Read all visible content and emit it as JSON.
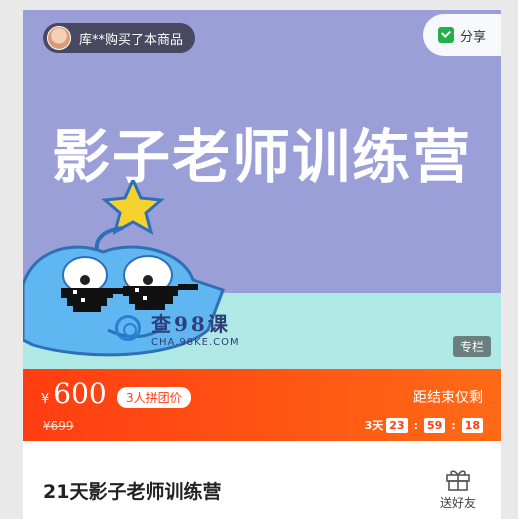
{
  "banner": {
    "buyer_notice": "库**购买了本商品",
    "share_label": "分享",
    "title": "影子老师训练营",
    "watermark_cn": "查98课",
    "watermark_en": "CHA.98KE.COM",
    "tag": "专栏"
  },
  "price_bar": {
    "currency": "¥",
    "price": "600",
    "group_badge": "3人拼团价",
    "original_price": "¥699",
    "countdown_label": "距结束仅剩",
    "countdown": {
      "days": "3天",
      "hours": "23",
      "minutes": "59",
      "seconds": "18",
      "separator": ":"
    }
  },
  "product": {
    "title": "21天影子老师训练营",
    "gift_label": "送好友"
  },
  "colors": {
    "banner_bg": "#9b9fd8",
    "banner_floor": "#aee9e6",
    "price_bar_start": "#ff3d12",
    "price_bar_end": "#ff6a16",
    "mascot_blue": "#5fb6f0",
    "star_yellow": "#f5d22d"
  }
}
